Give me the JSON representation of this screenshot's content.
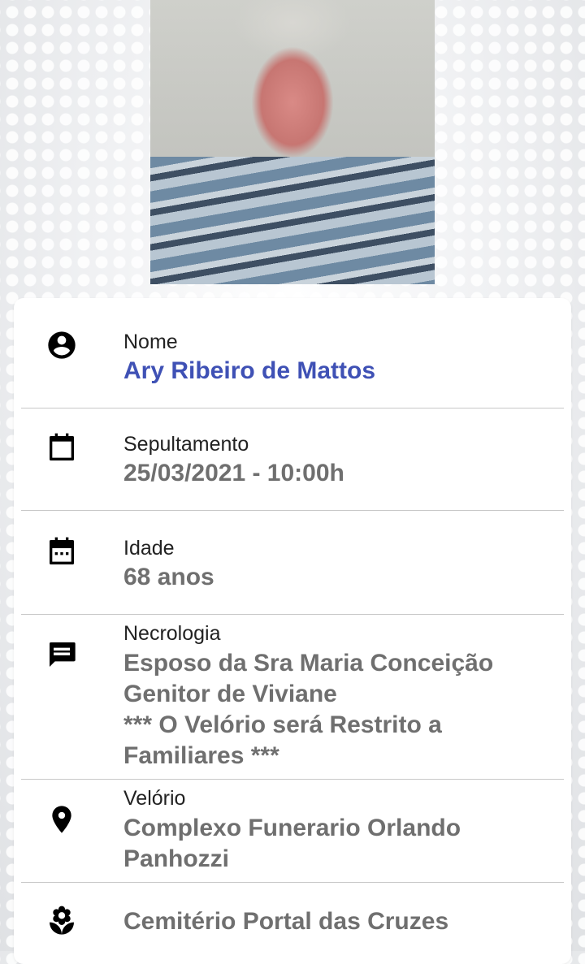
{
  "portrait": {
    "icon": "portrait-photo"
  },
  "fields": {
    "nome": {
      "label": "Nome",
      "value": "Ary Ribeiro de Mattos",
      "icon": "account-circle-icon"
    },
    "sepultamento": {
      "label": "Sepultamento",
      "value": "25/03/2021 - 10:00h",
      "icon": "calendar-icon"
    },
    "idade": {
      "label": "Idade",
      "value": "68 anos",
      "icon": "calendar-dots-icon"
    },
    "necrologia": {
      "label": "Necrologia",
      "lines": [
        "Esposo da Sra Maria Conceição",
        "Genitor de Viviane",
        "*** O Velório será Restrito a",
        "Familiares ***"
      ],
      "icon": "message-icon"
    },
    "velorio": {
      "label": "Velório",
      "lines": [
        "Complexo Funerario Orlando",
        "Panhozzi"
      ],
      "icon": "location-pin-icon"
    },
    "sepultura": {
      "value": "Cemitério Portal das Cruzes",
      "icon": "flower-icon"
    }
  },
  "colors": {
    "name_accent": "#3f51b5",
    "value_gray": "#6f6f6f",
    "icon": "#000000"
  }
}
